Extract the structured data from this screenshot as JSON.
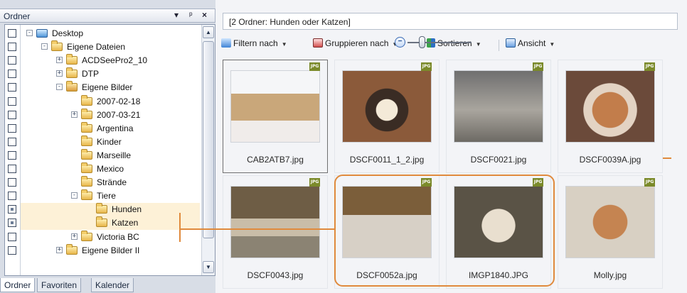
{
  "left": {
    "title": "Ordner",
    "controls": {
      "dropdown": "▾",
      "pin": "ᵖ",
      "close": "×"
    },
    "tree": [
      {
        "label": "Desktop",
        "level": 0,
        "expander": "-",
        "icon": "desktop-icon"
      },
      {
        "label": "Eigene Dateien",
        "level": 1,
        "expander": "-",
        "icon": "folder-icon"
      },
      {
        "label": "ACDSeePro2_10",
        "level": 2,
        "expander": "+",
        "icon": "folder-icon"
      },
      {
        "label": "DTP",
        "level": 2,
        "expander": "+",
        "icon": "folder-icon"
      },
      {
        "label": "Eigene Bilder",
        "level": 2,
        "expander": "-",
        "icon": "pictures-folder-icon"
      },
      {
        "label": "2007-02-18",
        "level": 3,
        "expander": "",
        "icon": "folder-icon"
      },
      {
        "label": "2007-03-21",
        "level": 3,
        "expander": "+",
        "icon": "folder-icon"
      },
      {
        "label": "Argentina",
        "level": 3,
        "expander": "",
        "icon": "folder-icon"
      },
      {
        "label": "Kinder",
        "level": 3,
        "expander": "",
        "icon": "folder-icon"
      },
      {
        "label": "Marseille",
        "level": 3,
        "expander": "",
        "icon": "folder-icon"
      },
      {
        "label": "Mexico",
        "level": 3,
        "expander": "",
        "icon": "folder-icon"
      },
      {
        "label": "Strände",
        "level": 3,
        "expander": "",
        "icon": "folder-icon"
      },
      {
        "label": "Tiere",
        "level": 3,
        "expander": "-",
        "icon": "folder-icon"
      },
      {
        "label": "Hunden",
        "level": 4,
        "expander": "",
        "icon": "folder-icon",
        "checked": true,
        "selected": true
      },
      {
        "label": "Katzen",
        "level": 4,
        "expander": "",
        "icon": "folder-icon",
        "checked": true,
        "selected": true
      },
      {
        "label": "Victoria BC",
        "level": 3,
        "expander": "+",
        "icon": "folder-icon"
      },
      {
        "label": "Eigene Bilder II",
        "level": 2,
        "expander": "+",
        "icon": "folder-icon"
      }
    ],
    "tabs": [
      "Ordner",
      "Favoriten",
      "Kalender"
    ],
    "active_tab": "Ordner"
  },
  "right": {
    "path": "[2 Ordner: Hunden oder Katzen]",
    "toolbar": {
      "filter": "Filtern nach",
      "group": "Gruppieren nach",
      "sort": "Sortieren",
      "view": "Ansicht"
    },
    "zoom": {
      "minus": "−"
    },
    "badge": "JPG",
    "thumbnails": [
      {
        "name": "CAB2ATB7.jpg",
        "selected": true
      },
      {
        "name": "DSCF0011_1_2.jpg",
        "selected": false
      },
      {
        "name": "DSCF0021.jpg",
        "selected": false
      },
      {
        "name": "DSCF0039A.jpg",
        "selected": false
      },
      {
        "name": "DSCF0043.jpg",
        "selected": false
      },
      {
        "name": "DSCF0052a.jpg",
        "selected": false
      },
      {
        "name": "IMGP1840.JPG",
        "selected": false
      },
      {
        "name": "Molly.jpg",
        "selected": false
      }
    ]
  },
  "colors": {
    "accent": "#e08a3c",
    "selection": "#fdf1d7"
  }
}
